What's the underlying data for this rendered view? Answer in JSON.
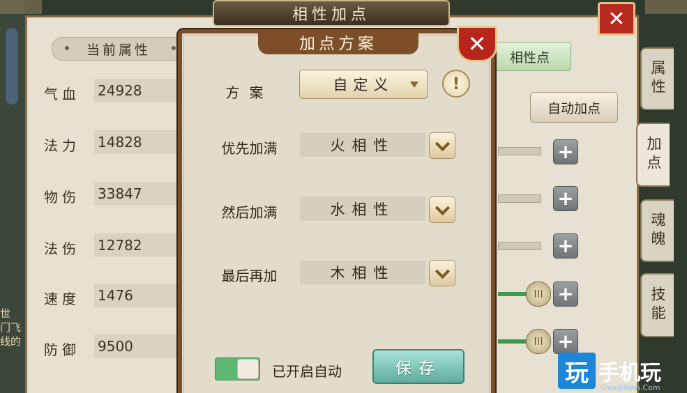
{
  "background": {
    "title": "相性加点",
    "current_tab": "当前属性",
    "affinity_points_btn": "相性点",
    "auto_add_btn": "自动加点",
    "stats": [
      {
        "label": "气血",
        "value": "24928"
      },
      {
        "label": "法力",
        "value": "14828"
      },
      {
        "label": "物伤",
        "value": "33847"
      },
      {
        "label": "法伤",
        "value": "12782"
      },
      {
        "label": "速度",
        "value": "1476"
      },
      {
        "label": "防御",
        "value": "9500"
      }
    ],
    "side_tabs": [
      "属性",
      "加点",
      "魂魄",
      "技能"
    ],
    "edge_text": "世\n门飞\n线的",
    "close_icon": "close-icon"
  },
  "modal": {
    "title": "加点方案",
    "scheme_label": "方案",
    "scheme_value": "自定义",
    "info_symbol": "!",
    "rows": [
      {
        "label": "优先加满",
        "value": "火相性"
      },
      {
        "label": "然后加满",
        "value": "水相性"
      },
      {
        "label": "最后再加",
        "value": "木相性"
      }
    ],
    "toggle_label": "已开启自动",
    "save_label": "保存",
    "close_symbol": "✕"
  },
  "watermark": {
    "logo": "玩",
    "text": "手机玩",
    "sub": "ShouJiWan.Com"
  },
  "colors": {
    "modal_border": "#7a4f2a",
    "close_red": "#b7261c",
    "save_teal": "#5fae9c",
    "toggle_green": "#5eb872"
  }
}
